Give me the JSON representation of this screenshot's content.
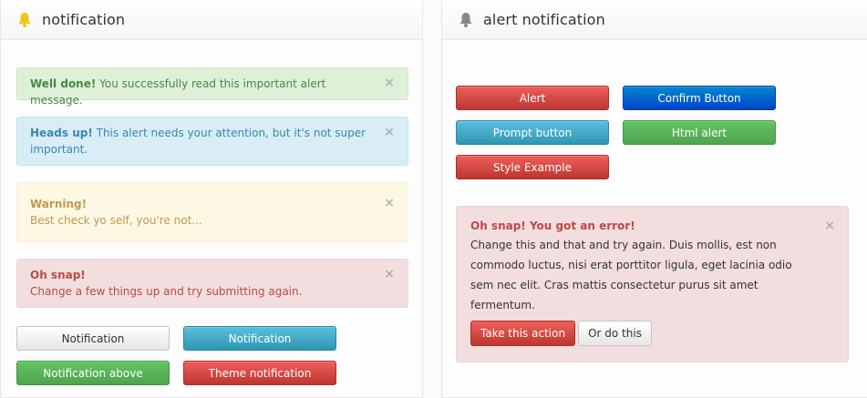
{
  "left_panel": {
    "title": "notification",
    "icon": "bell-icon",
    "alerts": [
      {
        "type": "success",
        "strong": "Well done!",
        "text": " You successfully read this important alert message.",
        "close": "×"
      },
      {
        "type": "info",
        "strong": "Heads up!",
        "text": " This alert needs your attention, but it's not super important.",
        "close": "×"
      },
      {
        "type": "warning",
        "strong": "Warning!",
        "text": "Best check yo self, you're not...",
        "close": "×"
      },
      {
        "type": "danger",
        "strong": "Oh snap!",
        "text": "Change a few things up and try submitting again.",
        "close": "×"
      }
    ],
    "buttons": {
      "notification_default": "Notification",
      "notification_info": "Notification",
      "notification_above": "Notification above",
      "theme_notification": "Theme notification"
    }
  },
  "right_panel": {
    "title": "alert notification",
    "icon": "bell-icon",
    "buttons": {
      "alert": "Alert",
      "confirm": "Confirm Button",
      "prompt": "Prompt button",
      "html_alert": "Html alert",
      "style_example": "Style Example"
    },
    "error_alert": {
      "heading": "Oh snap! You got an error!",
      "body": "Change this and that and try again. Duis mollis, est non commodo luctus, nisi erat porttitor ligula, eget lacinia odio sem nec elit. Cras mattis consectetur purus sit amet fermentum.",
      "close": "×",
      "primary_action": "Take this action",
      "secondary_action": "Or do this"
    }
  },
  "colors": {
    "success": "#dff0d8",
    "info": "#d9edf7",
    "warning": "#fcf8e3",
    "danger": "#f2dede",
    "bell_active": "#f0c419",
    "bell_inactive": "#888888"
  }
}
